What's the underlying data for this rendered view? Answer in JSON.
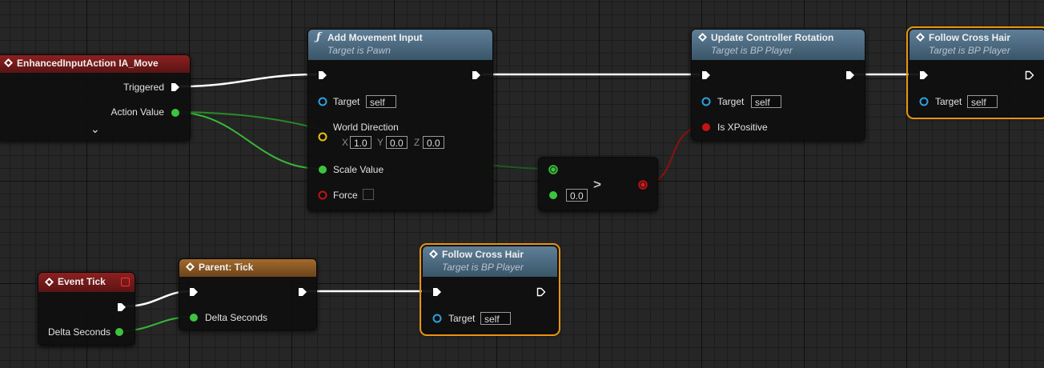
{
  "nodes": {
    "ia_move": {
      "title": "EnhancedInputAction IA_Move",
      "triggered": "Triggered",
      "action_value": "Action Value",
      "expand": "⌄"
    },
    "add_movement": {
      "icon": "ƒ",
      "title": "Add Movement Input",
      "subtitle": "Target is Pawn",
      "target_label": "Target",
      "target_value": "self",
      "world_direction": "World Direction",
      "x_label": "X",
      "x_value": "1.0",
      "y_label": "Y",
      "y_value": "0.0",
      "z_label": "Z",
      "z_value": "0.0",
      "scale_value": "Scale Value",
      "force": "Force"
    },
    "compare": {
      "b_value": "0.0",
      "op": ">"
    },
    "update_rotation": {
      "title": "Update Controller Rotation",
      "subtitle": "Target is BP Player",
      "target_label": "Target",
      "target_value": "self",
      "is_xpositive": "Is XPositive"
    },
    "follow_top": {
      "title": "Follow Cross Hair",
      "subtitle": "Target is BP Player",
      "target_label": "Target",
      "target_value": "self"
    },
    "event_tick": {
      "title": "Event Tick",
      "delta": "Delta Seconds"
    },
    "parent_tick": {
      "title": "Parent: Tick",
      "delta": "Delta Seconds"
    },
    "follow_bottom": {
      "title": "Follow Cross Hair",
      "subtitle": "Target is BP Player",
      "target_label": "Target",
      "target_value": "self"
    }
  },
  "colors": {
    "exec": "#ffffff",
    "float": "#3ec33e",
    "bool": "#c31414",
    "object": "#2e9fe0",
    "vector": "#f2c10e",
    "selected": "#e8930f"
  }
}
